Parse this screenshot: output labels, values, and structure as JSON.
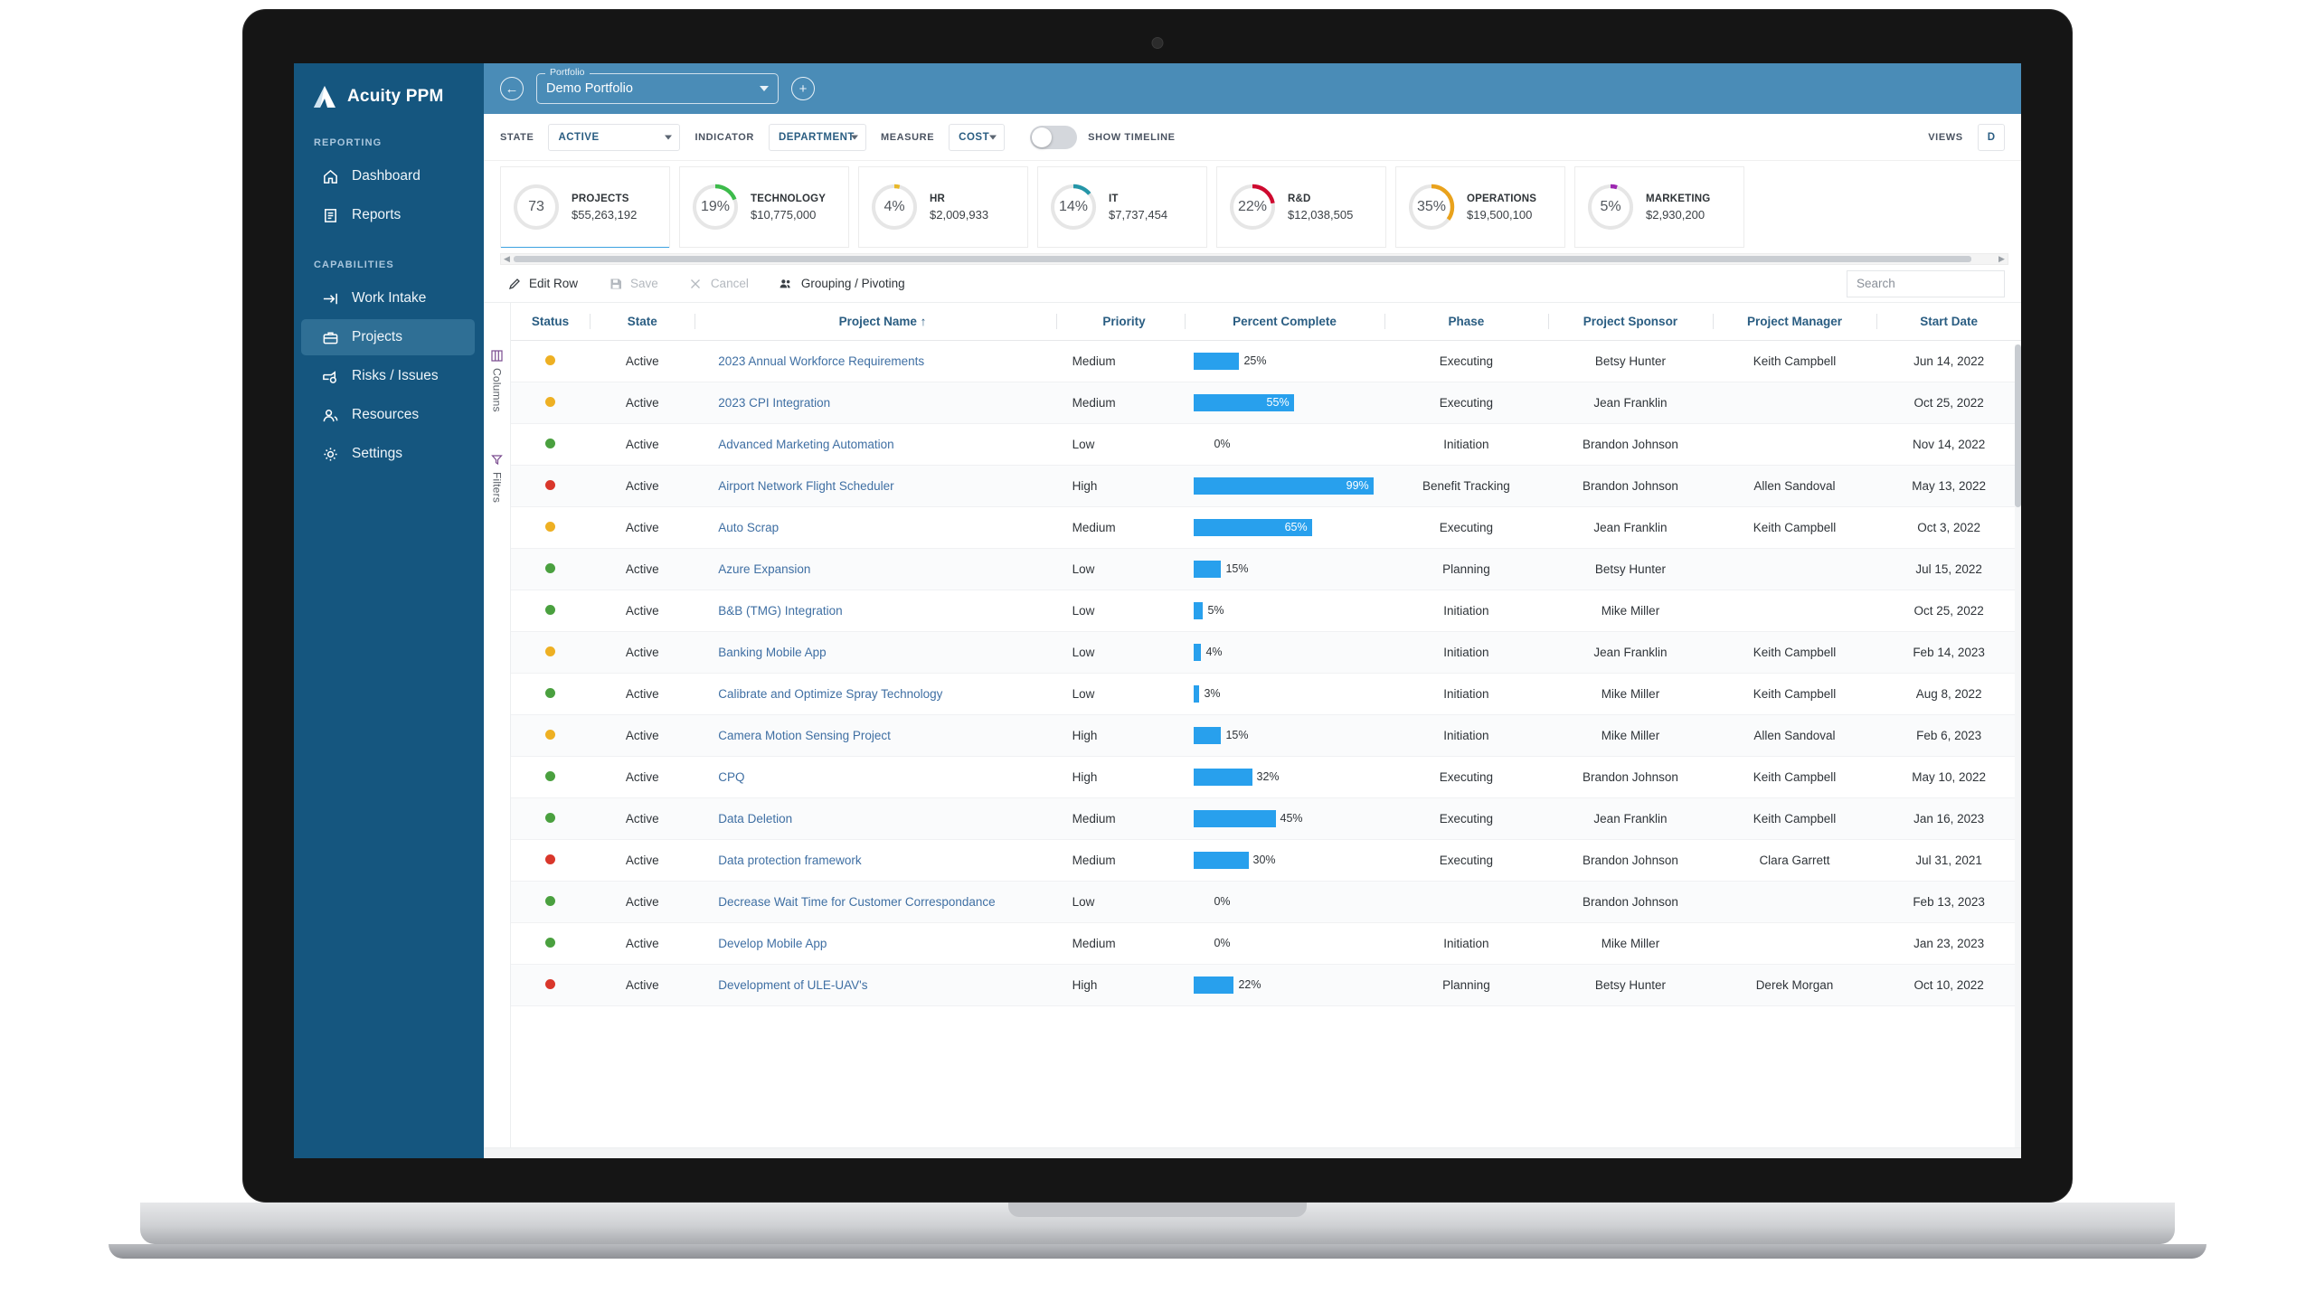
{
  "brand": {
    "name": "Acuity PPM",
    "logo_icon": "acuity-logo-icon"
  },
  "sidebar": {
    "sections": [
      {
        "label": "REPORTING",
        "items": [
          {
            "label": "Dashboard",
            "icon": "home-icon",
            "active": false
          },
          {
            "label": "Reports",
            "icon": "report-icon",
            "active": false
          }
        ]
      },
      {
        "label": "CAPABILITIES",
        "items": [
          {
            "label": "Work Intake",
            "icon": "arrow-into-icon",
            "active": false
          },
          {
            "label": "Projects",
            "icon": "briefcase-icon",
            "active": true
          },
          {
            "label": "Risks / Issues",
            "icon": "risk-icon",
            "active": false
          },
          {
            "label": "Resources",
            "icon": "people-icon",
            "active": false
          },
          {
            "label": "Settings",
            "icon": "gear-icon",
            "active": false
          }
        ]
      }
    ]
  },
  "portfolio_bar": {
    "back_icon": "back-arrow-circle-icon",
    "add_icon": "plus-circle-icon",
    "field_legend": "Portfolio",
    "field_value": "Demo Portfolio",
    "dropdown_icon": "chevron-down-icon"
  },
  "filter_bar": {
    "state_label": "STATE",
    "state_value": "ACTIVE",
    "indicator_label": "INDICATOR",
    "indicator_value": "DEPARTMENT",
    "measure_label": "MEASURE",
    "measure_value": "COST",
    "toggle_label": "SHOW TIMELINE",
    "toggle_on": false,
    "views_label": "VIEWS",
    "views_value": "D"
  },
  "kpis": [
    {
      "kind": "count",
      "center": "73",
      "title": "PROJECTS",
      "value": "$55,263,192",
      "percent": 0,
      "color": "#3da2e0",
      "selected": true
    },
    {
      "kind": "percent",
      "center": "19%",
      "title": "TECHNOLOGY",
      "value": "$10,775,000",
      "percent": 19,
      "color": "#3dbb4b",
      "selected": false
    },
    {
      "kind": "percent",
      "center": "4%",
      "title": "HR",
      "value": "$2,009,933",
      "percent": 4,
      "color": "#e8b82a",
      "selected": false
    },
    {
      "kind": "percent",
      "center": "14%",
      "title": "IT",
      "value": "$7,737,454",
      "percent": 14,
      "color": "#2596a8",
      "selected": false
    },
    {
      "kind": "percent",
      "center": "22%",
      "title": "R&D",
      "value": "$12,038,505",
      "percent": 22,
      "color": "#ce0a2f",
      "selected": false
    },
    {
      "kind": "percent",
      "center": "35%",
      "title": "OPERATIONS",
      "value": "$19,500,100",
      "percent": 35,
      "color": "#e9a21c",
      "selected": false
    },
    {
      "kind": "percent",
      "center": "5%",
      "title": "MARKETING",
      "value": "$2,930,200",
      "percent": 5,
      "color": "#9c27b0",
      "selected": false
    }
  ],
  "grid_toolbar": {
    "edit_row": "Edit Row",
    "save": "Save",
    "cancel": "Cancel",
    "grouping": "Grouping / Pivoting",
    "search_placeholder": "Search",
    "edit_icon": "pencil-icon",
    "save_icon": "floppy-disk-icon",
    "cancel_icon": "x-icon",
    "grouping_icon": "people-group-icon"
  },
  "side_tabs": [
    {
      "label": "Columns",
      "icon": "columns-icon"
    },
    {
      "label": "Filters",
      "icon": "funnel-icon"
    }
  ],
  "table": {
    "columns": [
      "Status",
      "State",
      "Project Name",
      "Priority",
      "Percent Complete",
      "Phase",
      "Project Sponsor",
      "Project Manager",
      "Start Date"
    ],
    "sorted_column": "Project Name",
    "sort_icon": "arrow-up-icon",
    "rows": [
      {
        "status": "amber",
        "state": "Active",
        "name": "2023 Annual Workforce Requirements",
        "priority": "Medium",
        "percent": 25,
        "phase": "Executing",
        "sponsor": "Betsy Hunter",
        "manager": "Keith Campbell",
        "start": "Jun 14, 2022"
      },
      {
        "status": "amber",
        "state": "Active",
        "name": "2023 CPI Integration",
        "priority": "Medium",
        "percent": 55,
        "phase": "Executing",
        "sponsor": "Jean Franklin",
        "manager": "",
        "start": "Oct 25, 2022"
      },
      {
        "status": "green",
        "state": "Active",
        "name": "Advanced Marketing Automation",
        "priority": "Low",
        "percent": 0,
        "phase": "Initiation",
        "sponsor": "Brandon Johnson",
        "manager": "",
        "start": "Nov 14, 2022"
      },
      {
        "status": "red",
        "state": "Active",
        "name": "Airport Network Flight Scheduler",
        "priority": "High",
        "percent": 99,
        "phase": "Benefit Tracking",
        "sponsor": "Brandon Johnson",
        "manager": "Allen Sandoval",
        "start": "May 13, 2022"
      },
      {
        "status": "amber",
        "state": "Active",
        "name": "Auto Scrap",
        "priority": "Medium",
        "percent": 65,
        "phase": "Executing",
        "sponsor": "Jean Franklin",
        "manager": "Keith Campbell",
        "start": "Oct 3, 2022"
      },
      {
        "status": "green",
        "state": "Active",
        "name": "Azure Expansion",
        "priority": "Low",
        "percent": 15,
        "phase": "Planning",
        "sponsor": "Betsy Hunter",
        "manager": "",
        "start": "Jul 15, 2022"
      },
      {
        "status": "green",
        "state": "Active",
        "name": "B&B (TMG) Integration",
        "priority": "Low",
        "percent": 5,
        "phase": "Initiation",
        "sponsor": "Mike Miller",
        "manager": "",
        "start": "Oct 25, 2022"
      },
      {
        "status": "amber",
        "state": "Active",
        "name": "Banking Mobile App",
        "priority": "Low",
        "percent": 4,
        "phase": "Initiation",
        "sponsor": "Jean Franklin",
        "manager": "Keith Campbell",
        "start": "Feb 14, 2023"
      },
      {
        "status": "green",
        "state": "Active",
        "name": "Calibrate and Optimize Spray Technology",
        "priority": "Low",
        "percent": 3,
        "phase": "Initiation",
        "sponsor": "Mike Miller",
        "manager": "Keith Campbell",
        "start": "Aug 8, 2022"
      },
      {
        "status": "amber",
        "state": "Active",
        "name": "Camera Motion Sensing Project",
        "priority": "High",
        "percent": 15,
        "phase": "Initiation",
        "sponsor": "Mike Miller",
        "manager": "Allen Sandoval",
        "start": "Feb 6, 2023"
      },
      {
        "status": "green",
        "state": "Active",
        "name": "CPQ",
        "priority": "High",
        "percent": 32,
        "phase": "Executing",
        "sponsor": "Brandon Johnson",
        "manager": "Keith Campbell",
        "start": "May 10, 2022"
      },
      {
        "status": "green",
        "state": "Active",
        "name": "Data Deletion",
        "priority": "Medium",
        "percent": 45,
        "phase": "Executing",
        "sponsor": "Jean Franklin",
        "manager": "Keith Campbell",
        "start": "Jan 16, 2023"
      },
      {
        "status": "red",
        "state": "Active",
        "name": "Data protection framework",
        "priority": "Medium",
        "percent": 30,
        "phase": "Executing",
        "sponsor": "Brandon Johnson",
        "manager": "Clara Garrett",
        "start": "Jul 31, 2021"
      },
      {
        "status": "green",
        "state": "Active",
        "name": "Decrease Wait Time for Customer Correspondance",
        "priority": "Low",
        "percent": 0,
        "phase": "",
        "sponsor": "Brandon Johnson",
        "manager": "",
        "start": "Feb 13, 2023"
      },
      {
        "status": "green",
        "state": "Active",
        "name": "Develop Mobile App",
        "priority": "Medium",
        "percent": 0,
        "phase": "Initiation",
        "sponsor": "Mike Miller",
        "manager": "",
        "start": "Jan 23, 2023"
      },
      {
        "status": "red",
        "state": "Active",
        "name": "Development of ULE-UAV's",
        "priority": "High",
        "percent": 22,
        "phase": "Planning",
        "sponsor": "Betsy Hunter",
        "manager": "Derek Morgan",
        "start": "Oct 10, 2022"
      }
    ]
  }
}
